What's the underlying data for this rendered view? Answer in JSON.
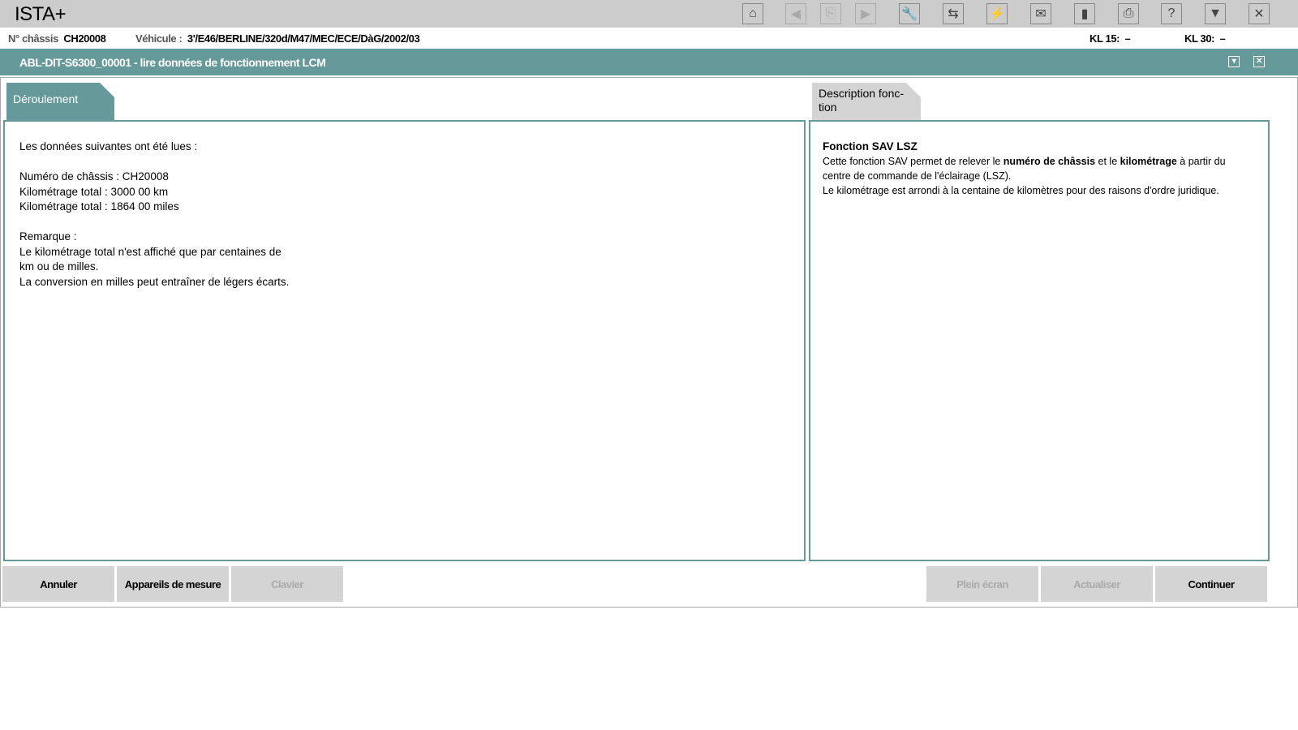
{
  "app": {
    "title": "ISTA+"
  },
  "toolbar": [
    {
      "name": "home-icon",
      "glyph": "⌂",
      "enabled": true
    },
    {
      "name": "back-icon",
      "glyph": "◀",
      "enabled": false
    },
    {
      "name": "copy-icon",
      "glyph": "⎘",
      "enabled": false
    },
    {
      "name": "forward-icon",
      "glyph": "▶",
      "enabled": false
    },
    {
      "name": "wrench-icon",
      "glyph": "🔧",
      "enabled": true
    },
    {
      "name": "module-icon",
      "glyph": "⇆",
      "enabled": true
    },
    {
      "name": "connector-icon",
      "glyph": "⚡",
      "enabled": true
    },
    {
      "name": "mail-icon",
      "glyph": "✉",
      "enabled": true
    },
    {
      "name": "battery-icon",
      "glyph": "▮",
      "enabled": true
    },
    {
      "name": "print-icon",
      "glyph": "⎙",
      "enabled": true
    },
    {
      "name": "help-icon",
      "glyph": "?",
      "enabled": true
    },
    {
      "name": "minimize-icon",
      "glyph": "▼",
      "enabled": true
    },
    {
      "name": "close-icon",
      "glyph": "✕",
      "enabled": true
    }
  ],
  "vehicle": {
    "chassis_label": "N° châssis",
    "chassis": "CH20008",
    "vehicle_label": "Véhicule :",
    "vehicle": "3'/E46/BERLINE/320d/M47/MEC/ECE/DàG/2002/03",
    "kl15_label": "KL 15:",
    "kl15": "–",
    "kl30_label": "KL 30:",
    "kl30": "–"
  },
  "window": {
    "title": "ABL-DIT-S6300_00001  -  lire données de fonctionnement LCM"
  },
  "left": {
    "tab": "Déroulement",
    "lines": [
      "Les données suivantes ont été lues :",
      "",
      "Numéro de châssis : CH20008",
      "Kilométrage total : 3000  00 km",
      "Kilométrage total : 1864  00 miles",
      "",
      "Remarque :",
      "Le kilométrage total n'est affiché que par centaines de",
      "km ou de milles.",
      "La conversion en milles peut entraîner de légers écarts."
    ]
  },
  "right": {
    "tab": "Description fonc-tion",
    "heading": "Fonction SAV LSZ",
    "p1a": "Cette fonction SAV permet de relever le ",
    "p1b": "numéro de châssis",
    "p1c": " et le ",
    "p1d": "kilométrage",
    "p1e": " à partir du centre de commande de l'éclairage (LSZ).",
    "p2": "Le kilométrage est arrondi à la centaine de kilomètres pour des raisons d'ordre juridique."
  },
  "buttons": {
    "cancel": "Annuler",
    "measure": "Appareils de mesure",
    "keyboard": "Clavier",
    "fullscreen": "Plein écran",
    "refresh": "Actualiser",
    "continue": "Continuer"
  }
}
